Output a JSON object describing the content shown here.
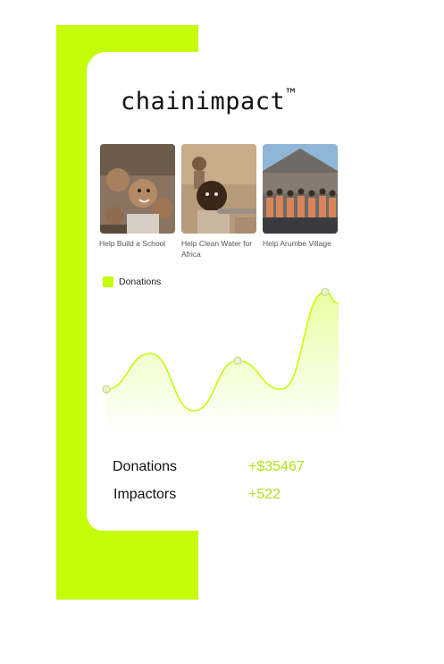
{
  "brand": {
    "name": "chainimpact",
    "trademark": "™"
  },
  "campaigns": [
    {
      "caption": "Help Build a School"
    },
    {
      "caption": "Help Clean Water for Africa"
    },
    {
      "caption": "Help Arumbe Village"
    }
  ],
  "legend": {
    "label": "Donations"
  },
  "chart_data": {
    "type": "area",
    "series": [
      {
        "name": "Donations",
        "values": [
          0.3,
          0.55,
          0.15,
          0.5,
          0.3,
          0.98,
          0.9
        ]
      }
    ],
    "highlighted_points": [
      0,
      3,
      5
    ],
    "color": "#c4fc0a"
  },
  "stats": {
    "donations_label": "Donations",
    "donations_value": "+$35467",
    "impactors_label": "Impactors",
    "impactors_value": "+522"
  },
  "colors": {
    "accent": "#c4fc0a",
    "value_text": "#b2e018"
  }
}
